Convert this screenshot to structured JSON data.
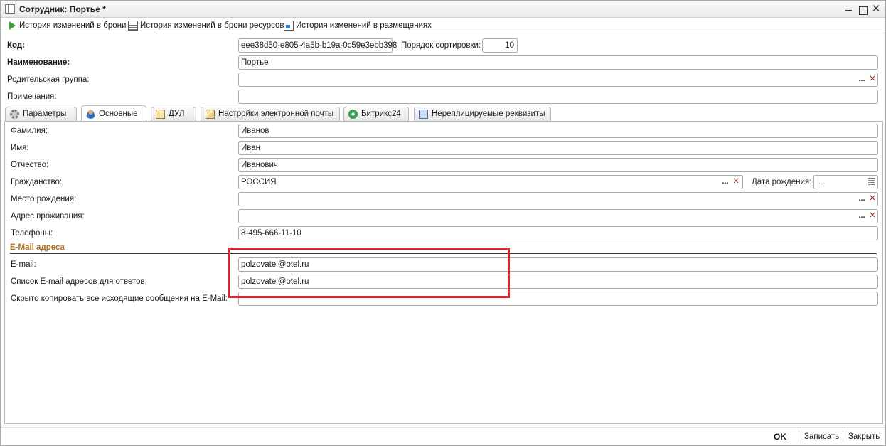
{
  "window": {
    "title": "Сотрудник: Портье *"
  },
  "toolbar": {
    "items": [
      {
        "label": "История изменений в брони",
        "icon": "play-icon"
      },
      {
        "label": "История изменений в брони ресурсов",
        "icon": "table-icon"
      },
      {
        "label": "История изменений в размещениях",
        "icon": "history-icon"
      }
    ]
  },
  "header": {
    "code_label": "Код:",
    "code_value": "eee38d50-e805-4a5b-b19a-0c59e3ebb398",
    "sort_label": "Порядок сортировки:",
    "sort_value": "10",
    "name_label": "Наименование:",
    "name_value": "Портье",
    "parent_label": "Родительская группа:",
    "parent_value": "",
    "notes_label": "Примечания:",
    "notes_value": ""
  },
  "tabs": [
    {
      "label": "Параметры",
      "icon": "gear-icon"
    },
    {
      "label": "Основные",
      "icon": "user-icon",
      "active": true
    },
    {
      "label": "ДУЛ",
      "icon": "id-document-icon"
    },
    {
      "label": "Настройки электронной почты",
      "icon": "mail-settings-icon"
    },
    {
      "label": "Битрикс24",
      "icon": "bitrix24-icon"
    },
    {
      "label": "Нереплицируемые реквизиты",
      "icon": "network-icon"
    }
  ],
  "main": {
    "last_name_label": "Фамилия:",
    "last_name_value": "Иванов",
    "first_name_label": "Имя:",
    "first_name_value": "Иван",
    "patronymic_label": "Отчество:",
    "patronymic_value": "Иванович",
    "citizenship_label": "Гражданство:",
    "citizenship_value": "РОССИЯ",
    "birth_date_label": "Дата рождения:",
    "birth_date_value": " .  .",
    "birth_place_label": "Место рождения:",
    "birth_place_value": "",
    "address_label": "Адрес проживания:",
    "address_value": "",
    "phones_label": "Телефоны:",
    "phones_value": "8-495-666-11-10",
    "email_section_title": "E-Mail адреса",
    "email_label": "E-mail:",
    "email_value": "polzovatel@otel.ru",
    "reply_label": "Список E-mail адресов для ответов:",
    "reply_value": "polzovatel@otel.ru",
    "bcc_label": "Скрыто копировать все исходящие сообщения на E-Mail:",
    "bcc_value": ""
  },
  "footer": {
    "ok_label": "OK",
    "save_label": "Записать",
    "close_label": "Закрыть"
  },
  "colors": {
    "highlight": "#e2232e",
    "section_title": "#b1701c"
  }
}
